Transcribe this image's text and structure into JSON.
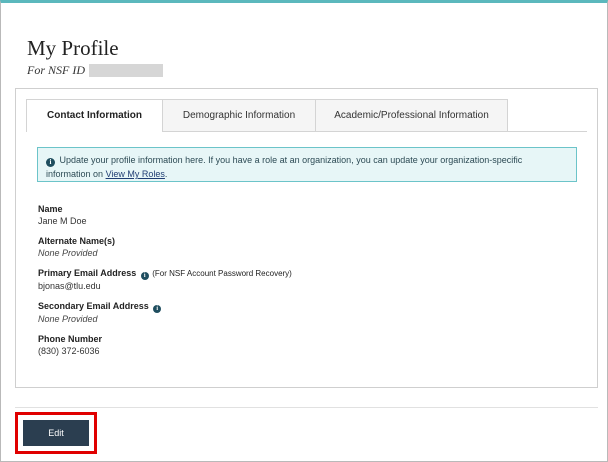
{
  "page": {
    "title": "My Profile",
    "nsf_id_label": "For NSF ID"
  },
  "tabs": [
    {
      "label": "Contact Information",
      "active": true
    },
    {
      "label": "Demographic Information",
      "active": false
    },
    {
      "label": "Academic/Professional Information",
      "active": false
    }
  ],
  "info": {
    "icon": "info-circle-icon",
    "text": "Update your profile information here. If you have a role at an organization, you can update your organization-specific information on",
    "link": "View My Roles",
    "end": "."
  },
  "fields": {
    "name": {
      "label": "Name",
      "value": "Jane M Doe"
    },
    "alternate_name": {
      "label": "Alternate Name(s)",
      "value": "None Provided"
    },
    "primary_email": {
      "label": "Primary Email Address",
      "note": "(For NSF Account Password Recovery)",
      "value": "bjonas@tlu.edu"
    },
    "secondary_email": {
      "label": "Secondary Email Address",
      "value": "None Provided"
    },
    "phone": {
      "label": "Phone Number",
      "value": "(830) 372-6036"
    }
  },
  "actions": {
    "edit_label": "Edit"
  },
  "colors": {
    "accent": "#5bb8bd",
    "button": "#2b3e50",
    "highlight": "#e00000",
    "info_bg": "#e7f6f7"
  }
}
